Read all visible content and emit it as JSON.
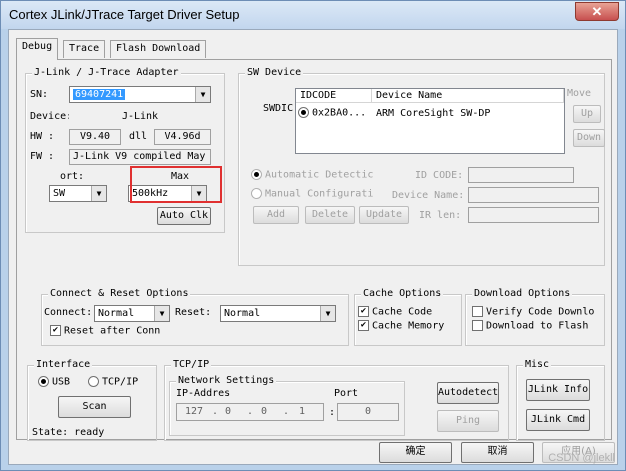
{
  "window": {
    "title": "Cortex JLink/JTrace Target Driver Setup",
    "close_glyph": "✕"
  },
  "tabs": [
    "Debug",
    "Trace",
    "Flash Download"
  ],
  "adapter": {
    "label": "J-Link / J-Trace Adapter",
    "sn_label": "SN:",
    "sn_value": "69407241",
    "device_label": "Device:",
    "device_value": "J-Link",
    "hw_label": "HW :",
    "hw_value": "V9.40",
    "dll_label": "dll",
    "dll_value": "V4.96d",
    "fw_label": "FW :",
    "fw_value": "J-Link V9 compiled May",
    "port_label": "ort:",
    "port_value": "SW",
    "max_label": "Max",
    "max_value": "500kHz",
    "auto_clk": "Auto Clk"
  },
  "sw_device": {
    "label": "SW Device",
    "swdi_label": "SWDIC",
    "columns": [
      "IDCODE",
      "Device Name"
    ],
    "rows": [
      {
        "idcode": "0x2BA0...",
        "name": "ARM CoreSight SW-DP"
      }
    ],
    "move_label": "Move",
    "up": "Up",
    "down": "Down",
    "auto_detect": "Automatic Detectic",
    "manual_config": "Manual Configurati",
    "id_code_label": "ID CODE:",
    "device_name_label": "Device Name:",
    "ir_len_label": "IR len:",
    "add": "Add",
    "delete": "Delete",
    "update": "Update"
  },
  "connect_reset": {
    "label": "Connect & Reset Options",
    "connect_label": "Connect:",
    "connect_value": "Normal",
    "reset_label": "Reset:",
    "reset_value": "Normal",
    "reset_after_conn": "Reset after Conn"
  },
  "cache": {
    "label": "Cache Options",
    "cache_code": "Cache Code",
    "cache_memory": "Cache Memory"
  },
  "download": {
    "label": "Download Options",
    "verify": "Verify Code Downlo",
    "download_flash": "Download to Flash"
  },
  "interface": {
    "label": "Interface",
    "usb": "USB",
    "tcpip": "TCP/IP",
    "scan": "Scan",
    "state": "State: ready"
  },
  "tcpip": {
    "label": "TCP/IP",
    "network_label": "Network Settings",
    "ip_label": "IP-Addres",
    "port_label": "Port",
    "ip": [
      "127",
      "0",
      "0",
      "1"
    ],
    "port": "0",
    "autodetect": "Autodetect",
    "ping": "Ping"
  },
  "misc": {
    "label": "Misc",
    "jlink_info": "JLink Info",
    "jlink_cmd": "JLink Cmd"
  },
  "footer": {
    "ok": "确定",
    "cancel": "取消",
    "apply": "应用(A)"
  },
  "watermark": "CSDN @jlekll"
}
